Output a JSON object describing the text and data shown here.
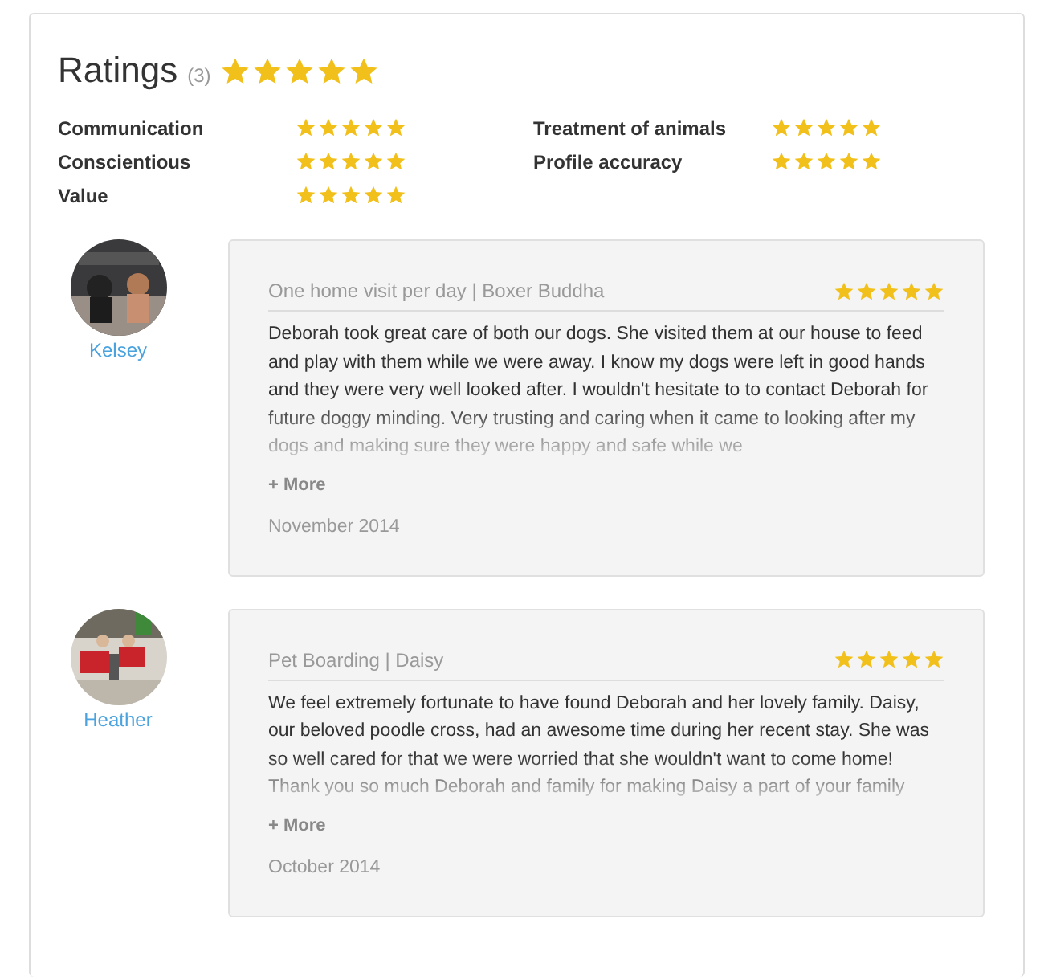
{
  "title": "Ratings",
  "count": "(3)",
  "stars": 5,
  "categories": [
    {
      "label": "Communication",
      "stars": 5
    },
    {
      "label": "Treatment of animals",
      "stars": 5
    },
    {
      "label": "Conscientious",
      "stars": 5
    },
    {
      "label": "Profile accuracy",
      "stars": 5
    },
    {
      "label": "Value",
      "stars": 5
    }
  ],
  "reviews": [
    {
      "name": "Kelsey",
      "service": "One home visit per day | Boxer Buddha",
      "stars": 5,
      "text": "Deborah took great care of both our dogs. She visited them at our house to feed and play with them while we were away. I know my dogs were left in good hands and they were very well looked after. I wouldn't hesitate to to contact Deborah for future doggy minding. Very trusting and caring when it came to looking after my dogs and making sure they were happy and safe while we",
      "more": "+ More",
      "date": "November 2014"
    },
    {
      "name": "Heather",
      "service": "Pet Boarding | Daisy",
      "stars": 5,
      "text": "We feel extremely fortunate to have found Deborah and her lovely family. Daisy, our beloved poodle cross, had an awesome time during her recent stay. She was so well cared for that we were worried that she wouldn't want to come home!\nThank you so much Deborah and family for making Daisy a part of your family",
      "more": "+ More",
      "date": "October 2014"
    }
  ]
}
